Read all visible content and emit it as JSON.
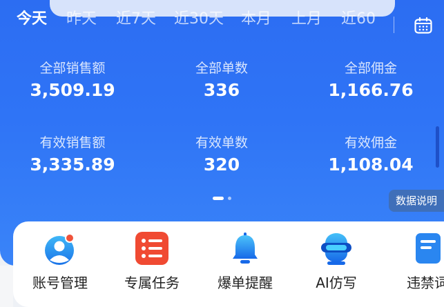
{
  "tabs": [
    "今天",
    "昨天",
    "近7天",
    "近30天",
    "本月",
    "上月",
    "近60"
  ],
  "active_tab": "今天",
  "stats": [
    {
      "label": "全部销售额",
      "value": "3,509.19"
    },
    {
      "label": "全部单数",
      "value": "336"
    },
    {
      "label": "全部佣金",
      "value": "1,166.76"
    },
    {
      "label": "有效销售额",
      "value": "3,335.89"
    },
    {
      "label": "有效单数",
      "value": "320"
    },
    {
      "label": "有效佣金",
      "value": "1,108.04"
    }
  ],
  "data_note_label": "数据说明",
  "menu": [
    {
      "label": "账号管理",
      "icon": "account-user-icon"
    },
    {
      "label": "专属任务",
      "icon": "task-list-icon"
    },
    {
      "label": "爆单提醒",
      "icon": "bell-icon"
    },
    {
      "label": "AI仿写",
      "icon": "vr-headset-icon"
    },
    {
      "label": "违禁词",
      "icon": "document-icon"
    }
  ],
  "colors": {
    "hero_blue": "#2f74f6",
    "accent_red": "#f0533b",
    "card_white": "#ffffff",
    "note_bg": "#3f6fb9"
  },
  "pager": {
    "pages": 2,
    "current": 1
  }
}
